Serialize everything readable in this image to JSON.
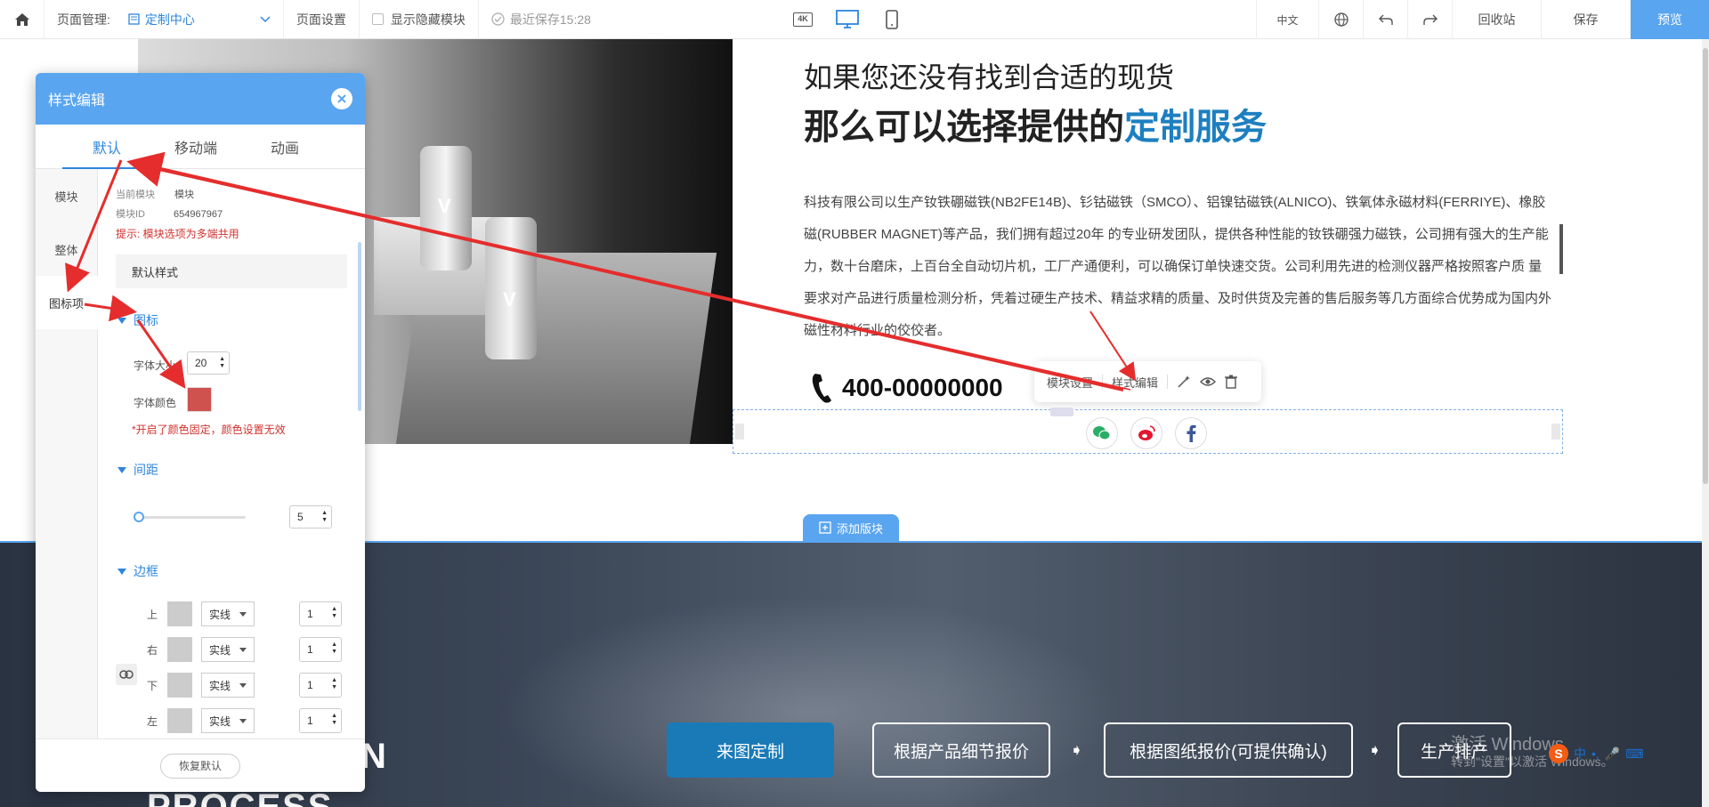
{
  "topbar": {
    "page_mgmt_label": "页面管理:",
    "page_select": "定制中心",
    "page_settings": "页面设置",
    "show_hidden": "显示隐藏模块",
    "last_saved": "最近保存15:28",
    "lang": "中文",
    "recycle": "回收站",
    "save": "保存",
    "preview": "预览",
    "device_4k": "4K"
  },
  "content": {
    "heading1": "如果您还没有找到合适的现货",
    "heading2_a": "那么可以选择提供的",
    "heading2_b": "定制服务",
    "description": "科技有限公司以生产钕铁硼磁铁(NB2FE14B)、钐钴磁铁（SMCO）、铝镍钴磁铁(ALNICO)、铁氧体永磁材料(FERRIYE)、橡胶磁(RUBBER MAGNET)等产品，我们拥有超过20年 的专业研发团队，提供各种性能的钕铁硼强力磁铁，公司拥有强大的生产能力，数十台磨床，上百台全自动切片机，工厂产通便利，可以确保订单快速交货。公司利用先进的检测仪器严格按照客户质 量要求对产品进行质量检测分析，凭着过硬生产技术、精益求精的质量、及时供货及完善的售后服务等几方面综合优势成为国内外磁性材料行业的佼佼者。",
    "phone": "400-00000000",
    "product_letter": "V",
    "module_settings": "模块设置",
    "style_edit": "样式编辑",
    "add_block": "添加版块",
    "bottom_word1": "N",
    "bottom_word2": "PROCESS",
    "steps": [
      "来图定制",
      "根据产品细节报价",
      "根据图纸报价(可提供确认)",
      "生产排产"
    ],
    "windows_wm1": "激活 Windows",
    "windows_wm2": "转到\"设置\"以激活 Windows。",
    "ime_text": "中"
  },
  "panel": {
    "title": "样式编辑",
    "tabs": [
      "默认",
      "移动端",
      "动画"
    ],
    "side": [
      "模块",
      "整体",
      "图标项"
    ],
    "current_module_label": "当前模块",
    "current_module_value": "模块",
    "module_id_label": "模块ID",
    "module_id_value": "654967967",
    "tip": "提示: 模块选项为多端共用",
    "default_style": "默认样式",
    "section_icon": "图标",
    "font_size_label": "字体大小",
    "font_size_value": "20",
    "font_color_label": "字体颜色",
    "font_color": "#d0524f",
    "color_warning": "*开启了颜色固定，颜色设置无效",
    "section_spacing": "间距",
    "spacing_value": "5",
    "spacing_fraction": 0.0,
    "section_border": "边框",
    "border_rows": [
      {
        "side": "上",
        "style": "实线",
        "width": "1"
      },
      {
        "side": "右",
        "style": "实线",
        "width": "1"
      },
      {
        "side": "下",
        "style": "实线",
        "width": "1"
      },
      {
        "side": "左",
        "style": "实线",
        "width": "1"
      }
    ],
    "restore": "恢复默认"
  },
  "colors": {
    "accent": "#5aa5ef",
    "highlight": "#1d7fc0",
    "annotation": "#e52d2d",
    "weibo": "#e6162d",
    "wechat": "#2aae67",
    "facebook": "#3b5998"
  }
}
